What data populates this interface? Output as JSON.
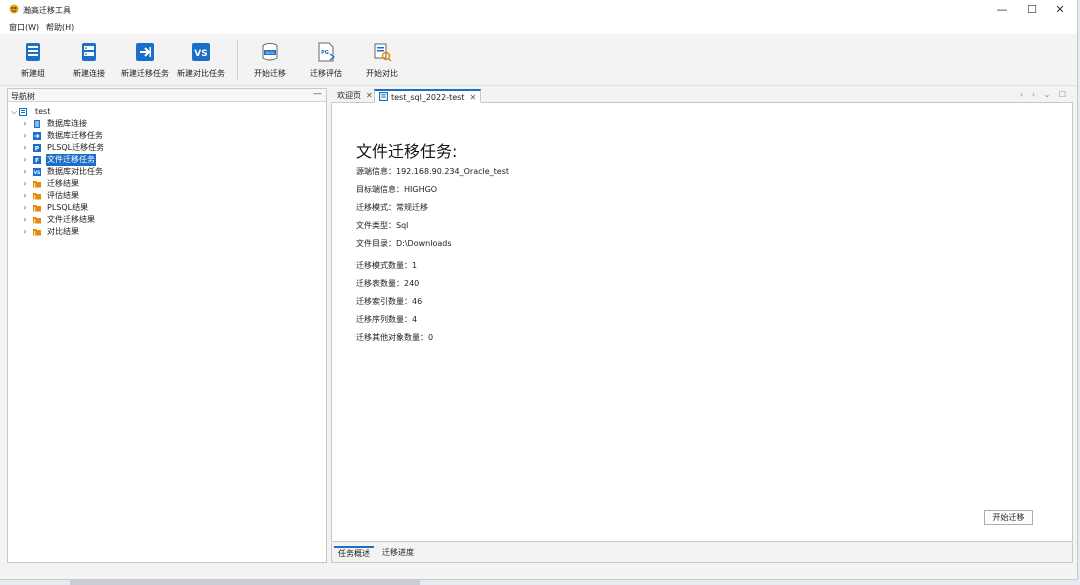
{
  "window": {
    "title": "瀚高迁移工具",
    "controls": {
      "minimize": "—",
      "maximize": "☐",
      "close": "✕"
    }
  },
  "menu": [
    {
      "label": "窗口(W)"
    },
    {
      "label": "帮助(H)"
    }
  ],
  "toolbar": {
    "new_group": "新建组",
    "new_connection": "新建连接",
    "new_migration_task": "新建迁移任务",
    "new_compare_task": "新建对比任务",
    "start_migration": "开始迁移",
    "migration_evaluation": "迁移评估",
    "start_compare": "开始对比"
  },
  "nav": {
    "title": "导航树",
    "minimize_label": "—",
    "root": "test",
    "items": [
      {
        "label": "数据库连接",
        "icon": "db-connection-icon"
      },
      {
        "label": "数据库迁移任务",
        "icon": "db-migration-task-icon"
      },
      {
        "label": "PLSQL迁移任务",
        "icon": "plsql-task-icon"
      },
      {
        "label": "文件迁移任务",
        "icon": "file-task-icon",
        "selected": true
      },
      {
        "label": "数据库对比任务",
        "icon": "compare-task-icon"
      },
      {
        "label": "迁移结果",
        "icon": "folder-icon"
      },
      {
        "label": "评估结果",
        "icon": "folder-icon"
      },
      {
        "label": "PLSQL结果",
        "icon": "folder-icon"
      },
      {
        "label": "文件迁移结果",
        "icon": "folder-icon"
      },
      {
        "label": "对比结果",
        "icon": "folder-icon"
      }
    ]
  },
  "editor_tabs": [
    {
      "label": "欢迎页"
    },
    {
      "label": "test_sql_2022-test",
      "active": true
    }
  ],
  "editor_tab_controls": "‹ › ⌄ ☐",
  "content": {
    "heading": "文件迁移任务:",
    "source_info": "源端信息：192.168.90.234_Oracle_test",
    "target_info": "目标端信息：HIGHGO",
    "migration_mode": "迁移模式：常规迁移",
    "file_type": "文件类型：Sql",
    "file_dir": "文件目录：D:\\Downloads",
    "schema_count": "迁移模式数量：1",
    "table_count": "迁移表数量：240",
    "index_count": "迁移索引数量：46",
    "sequence_count": "迁移序列数量：4",
    "other_count": "迁移其他对象数量：0",
    "start_button": "开始迁移"
  },
  "bottom_tabs": [
    {
      "label": "任务概述",
      "active": true
    },
    {
      "label": "迁移进度"
    }
  ],
  "colors": {
    "accent": "#1a6fc8",
    "folder": "#e8890c",
    "toolbar_icon": "#1a6fc8"
  }
}
